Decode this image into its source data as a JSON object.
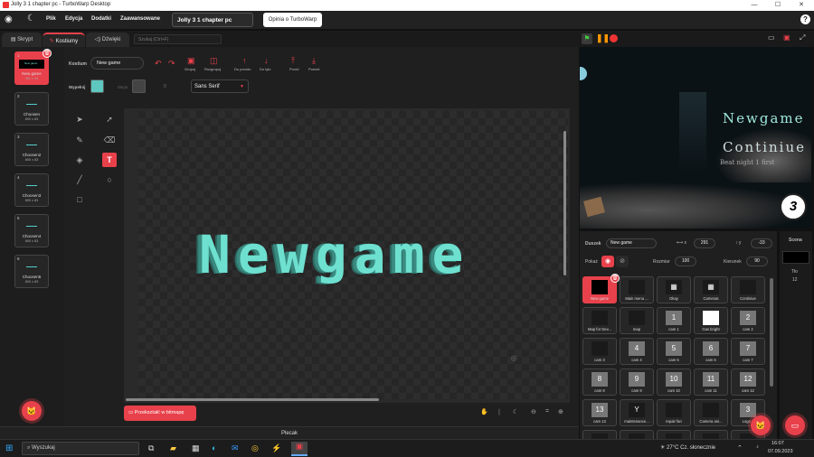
{
  "window": {
    "title": "Jolly 3 1 chapter pc - TurboWarp Desktop",
    "min": "—",
    "max": "☐",
    "close": "✕"
  },
  "menu": {
    "file": "Plik",
    "edit": "Edycja",
    "addons": "Dodatki",
    "advanced": "Zaawansowane",
    "project_title": "Jolly 3 1 chapter pc",
    "feedback": "Opinia o TurboWarp",
    "help": "?"
  },
  "tabs": {
    "code": "Skrypt",
    "costumes": "Kostiumy",
    "sounds": "Dźwięki",
    "search_placeholder": "Szukaj (Ctrl+F)"
  },
  "costumes": [
    {
      "num": "1",
      "name": "New game",
      "size": "391 x 33",
      "selected": true
    },
    {
      "num": "2",
      "name": "Choosen",
      "size": "800 x 83"
    },
    {
      "num": "3",
      "name": "Choosen2",
      "size": "800 x 83"
    },
    {
      "num": "4",
      "name": "Choosen3",
      "size": "800 x 83"
    },
    {
      "num": "5",
      "name": "Choosen4",
      "size": "800 x 83"
    },
    {
      "num": "6",
      "name": "Choosen5",
      "size": "800 x 83"
    }
  ],
  "editor": {
    "costume_label": "Kostium",
    "costume_name": "New game",
    "group": "Grupuj",
    "ungroup": "Rozgrupuj",
    "forward": "Do przodu",
    "backward": "Do tyłu",
    "front": "Przód",
    "back": "Powrót",
    "fill_label": "Wypełnij",
    "outline_label": "Zarys",
    "outline_size": "0",
    "font": "Sans Serif",
    "canvas_text": "Newgame",
    "convert_bitmap": "Przekształć w bitmapę",
    "fill_color": "#5ec8c0"
  },
  "stage": {
    "title1": "Newgame",
    "title2": "Continiue",
    "subtitle": "Beat night 1 first",
    "badge": "3"
  },
  "sprite": {
    "label": "Duszek",
    "name": "New game",
    "x": "291",
    "y": "-33",
    "show_label": "Pokaż",
    "size_label": "Rozmiar",
    "size": "100",
    "direction_label": "Kierunek",
    "direction": "90"
  },
  "sprites": [
    "New game",
    "Main menu ...",
    "Okay",
    "Cameras",
    "Continiue",
    "Map for Dev...",
    "map",
    "cam 1",
    "Gas bright",
    "cam 2",
    "cam 3",
    "cam 4",
    "cam 5",
    "cam 6",
    "cam 7",
    "cam 8",
    "cam 9",
    "cam 10",
    "cam 11",
    "cam 12",
    "cam 13",
    "maintenance...",
    "repair fan",
    "Camera ani...",
    "Logo 3",
    "",
    "",
    "",
    "",
    ""
  ],
  "sprite_thumbs": [
    "",
    "",
    "▦",
    "▦",
    "",
    "",
    "",
    "1",
    "",
    "2",
    "",
    "4",
    "5",
    "6",
    "7",
    "8",
    "9",
    "10",
    "11",
    "12",
    "13",
    "Y",
    "",
    "",
    "3",
    "",
    "",
    "",
    "",
    ""
  ],
  "scene": {
    "label": "Scena",
    "backdrops_label": "Tło",
    "backdrops": "12"
  },
  "backpack": "Plecak",
  "taskbar": {
    "search": "Wyszukaj",
    "weather": "27°C  Cz. słonecznie",
    "time": "16:07",
    "date": "07.09.2023"
  }
}
